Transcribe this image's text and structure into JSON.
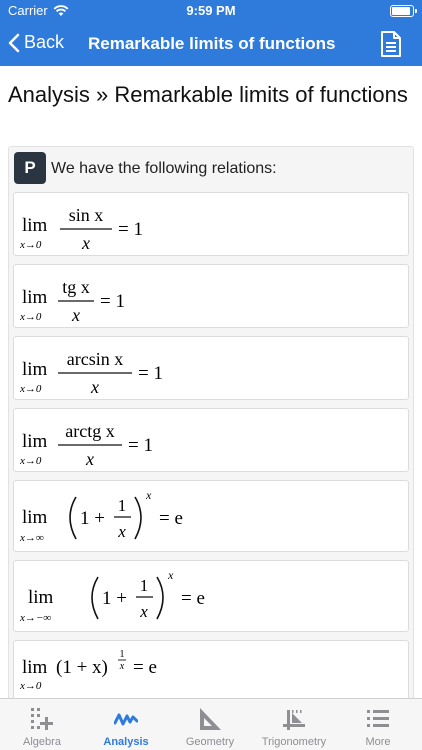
{
  "status_bar": {
    "carrier": "Carrier",
    "time": "9:59 PM"
  },
  "nav": {
    "back_label": "Back",
    "title": "Remarkable limits of functions"
  },
  "page": {
    "title": "Analysis » Remarkable limits of functions"
  },
  "property": {
    "badge": "P",
    "intro": "We have the following relations:",
    "formulas": {
      "f1": {
        "lim": "lim",
        "sub": "x→0",
        "num": "sin x",
        "den": "x",
        "rhs": "= 1"
      },
      "f2": {
        "lim": "lim",
        "sub": "x→0",
        "num": "tg x",
        "den": "x",
        "rhs": "= 1"
      },
      "f3": {
        "lim": "lim",
        "sub": "x→0",
        "num": "arcsin x",
        "den": "x",
        "rhs": "= 1"
      },
      "f4": {
        "lim": "lim",
        "sub": "x→0",
        "num": "arctg x",
        "den": "x",
        "rhs": "= 1"
      },
      "f5": {
        "lim": "lim",
        "sub": "x→∞",
        "one_plus": "1 +",
        "num": "1",
        "den": "x",
        "exp": "x",
        "rhs": "= e"
      },
      "f6": {
        "lim": "lim",
        "sub": "x→−∞",
        "one_plus": "1 +",
        "num": "1",
        "den": "x",
        "exp": "x",
        "rhs": "= e"
      },
      "f7": {
        "lim": "lim",
        "sub": "x→0",
        "base": "(1 + x)",
        "exp_num": "1",
        "exp_den": "x",
        "rhs": "= e"
      }
    }
  },
  "tabs": [
    {
      "label": "Algebra",
      "icon": "algebra-icon",
      "active": false
    },
    {
      "label": "Analysis",
      "icon": "analysis-icon",
      "active": true
    },
    {
      "label": "Geometry",
      "icon": "geometry-icon",
      "active": false
    },
    {
      "label": "Trigonometry",
      "icon": "trigonometry-icon",
      "active": false
    },
    {
      "label": "More",
      "icon": "more-icon",
      "active": false
    }
  ],
  "colors": {
    "accent": "#2f7bdc",
    "badge": "#2b3542",
    "tab_inactive": "#8e8e93"
  }
}
